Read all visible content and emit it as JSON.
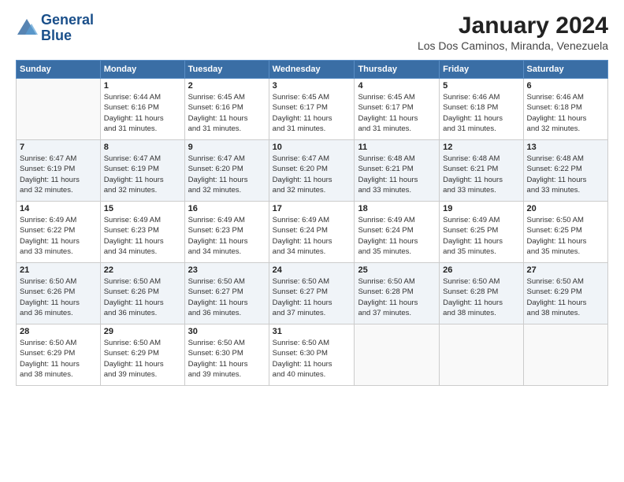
{
  "logo": {
    "line1": "General",
    "line2": "Blue"
  },
  "title": "January 2024",
  "subtitle": "Los Dos Caminos, Miranda, Venezuela",
  "weekdays": [
    "Sunday",
    "Monday",
    "Tuesday",
    "Wednesday",
    "Thursday",
    "Friday",
    "Saturday"
  ],
  "weeks": [
    [
      {
        "day": "",
        "info": ""
      },
      {
        "day": "1",
        "info": "Sunrise: 6:44 AM\nSunset: 6:16 PM\nDaylight: 11 hours\nand 31 minutes."
      },
      {
        "day": "2",
        "info": "Sunrise: 6:45 AM\nSunset: 6:16 PM\nDaylight: 11 hours\nand 31 minutes."
      },
      {
        "day": "3",
        "info": "Sunrise: 6:45 AM\nSunset: 6:17 PM\nDaylight: 11 hours\nand 31 minutes."
      },
      {
        "day": "4",
        "info": "Sunrise: 6:45 AM\nSunset: 6:17 PM\nDaylight: 11 hours\nand 31 minutes."
      },
      {
        "day": "5",
        "info": "Sunrise: 6:46 AM\nSunset: 6:18 PM\nDaylight: 11 hours\nand 31 minutes."
      },
      {
        "day": "6",
        "info": "Sunrise: 6:46 AM\nSunset: 6:18 PM\nDaylight: 11 hours\nand 32 minutes."
      }
    ],
    [
      {
        "day": "7",
        "info": "Sunrise: 6:47 AM\nSunset: 6:19 PM\nDaylight: 11 hours\nand 32 minutes."
      },
      {
        "day": "8",
        "info": "Sunrise: 6:47 AM\nSunset: 6:19 PM\nDaylight: 11 hours\nand 32 minutes."
      },
      {
        "day": "9",
        "info": "Sunrise: 6:47 AM\nSunset: 6:20 PM\nDaylight: 11 hours\nand 32 minutes."
      },
      {
        "day": "10",
        "info": "Sunrise: 6:47 AM\nSunset: 6:20 PM\nDaylight: 11 hours\nand 32 minutes."
      },
      {
        "day": "11",
        "info": "Sunrise: 6:48 AM\nSunset: 6:21 PM\nDaylight: 11 hours\nand 33 minutes."
      },
      {
        "day": "12",
        "info": "Sunrise: 6:48 AM\nSunset: 6:21 PM\nDaylight: 11 hours\nand 33 minutes."
      },
      {
        "day": "13",
        "info": "Sunrise: 6:48 AM\nSunset: 6:22 PM\nDaylight: 11 hours\nand 33 minutes."
      }
    ],
    [
      {
        "day": "14",
        "info": "Sunrise: 6:49 AM\nSunset: 6:22 PM\nDaylight: 11 hours\nand 33 minutes."
      },
      {
        "day": "15",
        "info": "Sunrise: 6:49 AM\nSunset: 6:23 PM\nDaylight: 11 hours\nand 34 minutes."
      },
      {
        "day": "16",
        "info": "Sunrise: 6:49 AM\nSunset: 6:23 PM\nDaylight: 11 hours\nand 34 minutes."
      },
      {
        "day": "17",
        "info": "Sunrise: 6:49 AM\nSunset: 6:24 PM\nDaylight: 11 hours\nand 34 minutes."
      },
      {
        "day": "18",
        "info": "Sunrise: 6:49 AM\nSunset: 6:24 PM\nDaylight: 11 hours\nand 35 minutes."
      },
      {
        "day": "19",
        "info": "Sunrise: 6:49 AM\nSunset: 6:25 PM\nDaylight: 11 hours\nand 35 minutes."
      },
      {
        "day": "20",
        "info": "Sunrise: 6:50 AM\nSunset: 6:25 PM\nDaylight: 11 hours\nand 35 minutes."
      }
    ],
    [
      {
        "day": "21",
        "info": "Sunrise: 6:50 AM\nSunset: 6:26 PM\nDaylight: 11 hours\nand 36 minutes."
      },
      {
        "day": "22",
        "info": "Sunrise: 6:50 AM\nSunset: 6:26 PM\nDaylight: 11 hours\nand 36 minutes."
      },
      {
        "day": "23",
        "info": "Sunrise: 6:50 AM\nSunset: 6:27 PM\nDaylight: 11 hours\nand 36 minutes."
      },
      {
        "day": "24",
        "info": "Sunrise: 6:50 AM\nSunset: 6:27 PM\nDaylight: 11 hours\nand 37 minutes."
      },
      {
        "day": "25",
        "info": "Sunrise: 6:50 AM\nSunset: 6:28 PM\nDaylight: 11 hours\nand 37 minutes."
      },
      {
        "day": "26",
        "info": "Sunrise: 6:50 AM\nSunset: 6:28 PM\nDaylight: 11 hours\nand 38 minutes."
      },
      {
        "day": "27",
        "info": "Sunrise: 6:50 AM\nSunset: 6:29 PM\nDaylight: 11 hours\nand 38 minutes."
      }
    ],
    [
      {
        "day": "28",
        "info": "Sunrise: 6:50 AM\nSunset: 6:29 PM\nDaylight: 11 hours\nand 38 minutes."
      },
      {
        "day": "29",
        "info": "Sunrise: 6:50 AM\nSunset: 6:29 PM\nDaylight: 11 hours\nand 39 minutes."
      },
      {
        "day": "30",
        "info": "Sunrise: 6:50 AM\nSunset: 6:30 PM\nDaylight: 11 hours\nand 39 minutes."
      },
      {
        "day": "31",
        "info": "Sunrise: 6:50 AM\nSunset: 6:30 PM\nDaylight: 11 hours\nand 40 minutes."
      },
      {
        "day": "",
        "info": ""
      },
      {
        "day": "",
        "info": ""
      },
      {
        "day": "",
        "info": ""
      }
    ]
  ]
}
